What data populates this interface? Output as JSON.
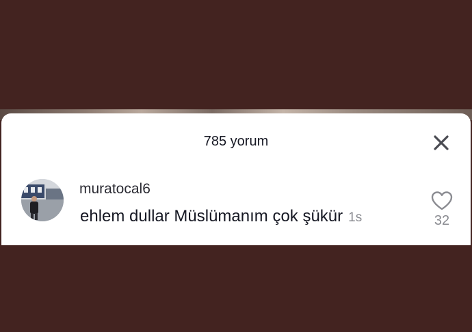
{
  "comments_panel": {
    "title": "785 yorum",
    "close_icon": "close-icon"
  },
  "comment": {
    "username": "muratocal6",
    "text": "ehlem dullar Müslümanım çok şükür",
    "time": "1s",
    "likes": "32",
    "like_icon": "heart-outline-icon"
  },
  "colors": {
    "background": "#432320",
    "sheet": "#ffffff",
    "text_primary": "#161823",
    "text_secondary": "#8a8b91"
  }
}
